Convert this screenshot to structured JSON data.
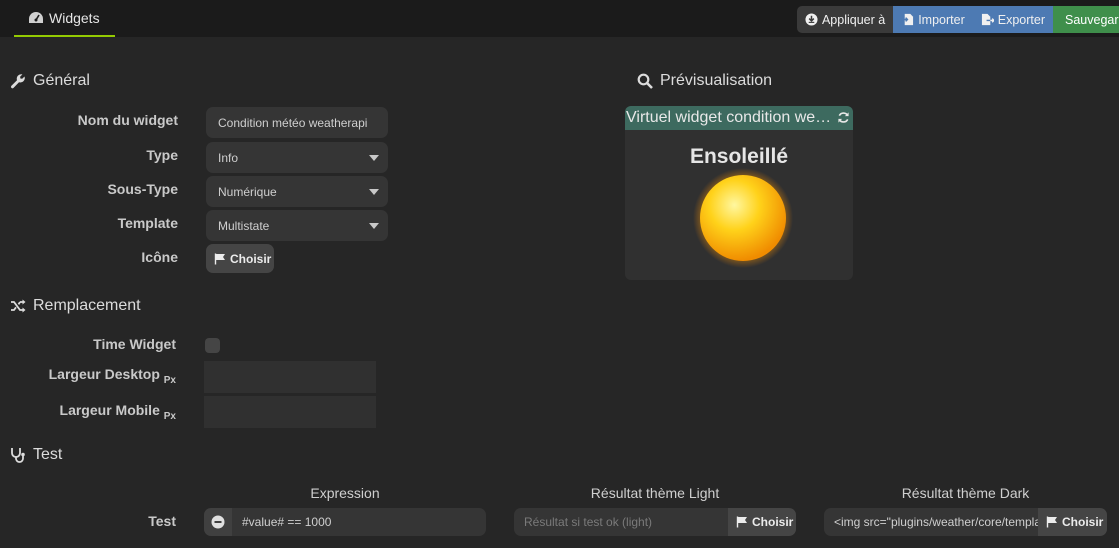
{
  "topbar": {
    "tab_label": "Widgets",
    "apply_label": "Appliquer à",
    "import_label": "Importer",
    "export_label": "Exporter",
    "save_label": "Sauvegarder"
  },
  "general": {
    "title": "Général",
    "name_label": "Nom du widget",
    "name_value": "Condition météo weatherapi",
    "type_label": "Type",
    "type_value": "Info",
    "subtype_label": "Sous-Type",
    "subtype_value": "Numérique",
    "template_label": "Template",
    "template_value": "Multistate",
    "icon_label": "Icône",
    "choose_label": "Choisir"
  },
  "preview": {
    "title": "Prévisualisation",
    "widget_name": "Virtuel widget condition weatherapi",
    "state": "Ensoleillé"
  },
  "replacement": {
    "title": "Remplacement",
    "time_widget_label": "Time Widget",
    "width_desktop_label": "Largeur Desktop",
    "width_mobile_label": "Largeur Mobile",
    "unit": "Px"
  },
  "test": {
    "title": "Test",
    "col_expression": "Expression",
    "col_light": "Résultat thème Light",
    "col_dark": "Résultat thème Dark",
    "row_label": "Test",
    "expression_value": "#value# == 1000",
    "light_placeholder": "Résultat si test ok (light)",
    "dark_value": "<img src=\"plugins/weather/core/template",
    "choose_label": "Choisir"
  },
  "colors": {
    "tab_accent": "#94ca02",
    "import_export": "#4d7ab3",
    "save": "#3f8f4b",
    "preview_header": "#3d6a5f"
  }
}
